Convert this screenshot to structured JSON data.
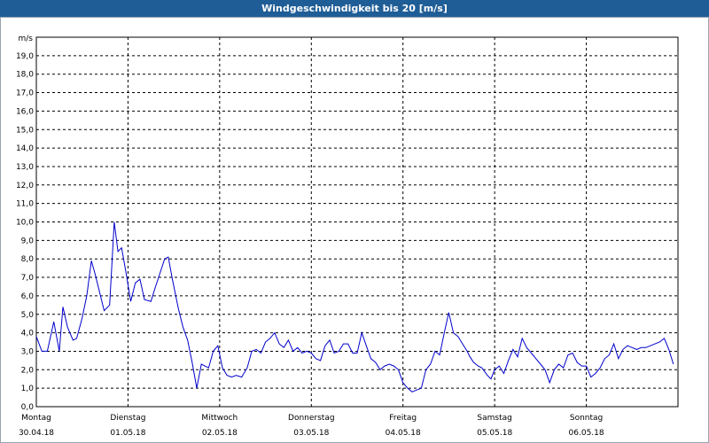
{
  "window": {
    "title": "Windgeschwindigkeit bis 20 [m/s]"
  },
  "chart_data": {
    "type": "line",
    "title": "Windgeschwindigkeit bis 20 [m/s]",
    "ylabel": "m/s",
    "xlabel": "",
    "ylim": [
      0,
      20
    ],
    "xlim": [
      0,
      7
    ],
    "y_ticks": [
      "0,0",
      "1,0",
      "2,0",
      "3,0",
      "4,0",
      "5,0",
      "6,0",
      "7,0",
      "8,0",
      "9,0",
      "10,0",
      "11,0",
      "12,0",
      "13,0",
      "14,0",
      "15,0",
      "16,0",
      "17,0",
      "18,0",
      "19,0"
    ],
    "x_ticks": [
      {
        "day": "Montag",
        "date": "30.04.18"
      },
      {
        "day": "Dienstag",
        "date": "01.05.18"
      },
      {
        "day": "Mittwoch",
        "date": "02.05.18"
      },
      {
        "day": "Donnerstag",
        "date": "03.05.18"
      },
      {
        "day": "Freitag",
        "date": "04.05.18"
      },
      {
        "day": "Samstag",
        "date": "05.05.18"
      },
      {
        "day": "Sonntag",
        "date": "06.05.18"
      }
    ],
    "grid": true,
    "colors": {
      "line": "#0000cc",
      "grid": "#000000"
    },
    "series": [
      {
        "x": [
          0.0,
          0.06,
          0.12,
          0.19,
          0.25,
          0.29,
          0.34,
          0.4,
          0.44,
          0.5,
          0.55,
          0.6,
          0.64,
          0.7,
          0.74,
          0.8,
          0.85,
          0.89,
          0.93,
          0.98,
          1.03,
          1.08,
          1.13,
          1.18,
          1.25,
          1.3,
          1.4,
          1.44,
          1.48,
          1.55,
          1.6,
          1.65,
          1.7,
          1.75,
          1.8,
          1.88,
          1.93,
          1.98,
          2.03,
          2.08,
          2.13,
          2.18,
          2.24,
          2.3,
          2.35,
          2.4,
          2.45,
          2.5,
          2.55,
          2.6,
          2.65,
          2.7,
          2.75,
          2.8,
          2.85,
          2.9,
          2.95,
          3.0,
          3.05,
          3.1,
          3.15,
          3.2,
          3.25,
          3.3,
          3.35,
          3.4,
          3.45,
          3.5,
          3.55,
          3.6,
          3.65,
          3.7,
          3.75,
          3.8,
          3.85,
          3.9,
          3.95,
          4.0,
          4.05,
          4.1,
          4.15,
          4.2,
          4.25,
          4.3,
          4.35,
          4.4,
          4.45,
          4.5,
          4.55,
          4.6,
          4.65,
          4.7,
          4.73,
          4.77,
          4.82,
          4.86,
          4.92,
          4.96,
          5.0,
          5.05,
          5.1,
          5.15,
          5.2,
          5.25,
          5.3,
          5.35,
          5.4,
          5.45,
          5.5,
          5.55,
          5.6,
          5.65,
          5.7,
          5.75,
          5.8,
          5.85,
          5.9,
          5.95,
          6.0,
          6.05,
          6.1,
          6.15,
          6.2,
          6.25,
          6.3,
          6.35,
          6.4,
          6.45,
          6.5,
          6.55,
          6.6,
          6.65,
          6.7,
          6.75,
          6.8,
          6.85,
          6.9,
          6.95
        ],
        "y": [
          3.8,
          3.0,
          3.0,
          4.6,
          3.0,
          5.4,
          4.3,
          3.6,
          3.7,
          4.8,
          6.0,
          7.9,
          7.2,
          6.0,
          5.2,
          5.5,
          10.0,
          8.4,
          8.6,
          7.2,
          5.7,
          6.7,
          6.9,
          5.8,
          5.7,
          6.5,
          8.0,
          8.1,
          7.0,
          5.3,
          4.3,
          3.6,
          2.4,
          1.0,
          2.3,
          2.1,
          3.0,
          3.3,
          2.1,
          1.7,
          1.6,
          1.7,
          1.6,
          2.1,
          3.0,
          3.1,
          2.9,
          3.5,
          3.7,
          4.0,
          3.4,
          3.2,
          3.6,
          3.0,
          3.2,
          2.9,
          3.0,
          2.9,
          2.6,
          2.5,
          3.3,
          3.6,
          2.9,
          3.0,
          3.4,
          3.4,
          2.9,
          2.9,
          4.0,
          3.3,
          2.6,
          2.4,
          2.0,
          2.2,
          2.3,
          2.2,
          2.0,
          1.3,
          1.0,
          0.8,
          0.9,
          1.0,
          2.0,
          2.3,
          3.0,
          2.8,
          4.0,
          5.1,
          4.0,
          3.8,
          3.4,
          3.0,
          2.7,
          2.4,
          2.2,
          2.1,
          1.7,
          1.5,
          2.0,
          2.2,
          1.8,
          2.5,
          3.1,
          2.7,
          3.7,
          3.2,
          2.9,
          2.6,
          2.3,
          2.0,
          1.3,
          2.0,
          2.3,
          2.1,
          2.8,
          2.9,
          2.4,
          2.2,
          2.2,
          1.6,
          1.8,
          2.1,
          2.6,
          2.8,
          3.4,
          2.6,
          3.1,
          3.3,
          3.2,
          3.1,
          3.2,
          3.2,
          3.3,
          3.4,
          3.5,
          3.7,
          3.1,
          2.3
        ]
      }
    ]
  }
}
